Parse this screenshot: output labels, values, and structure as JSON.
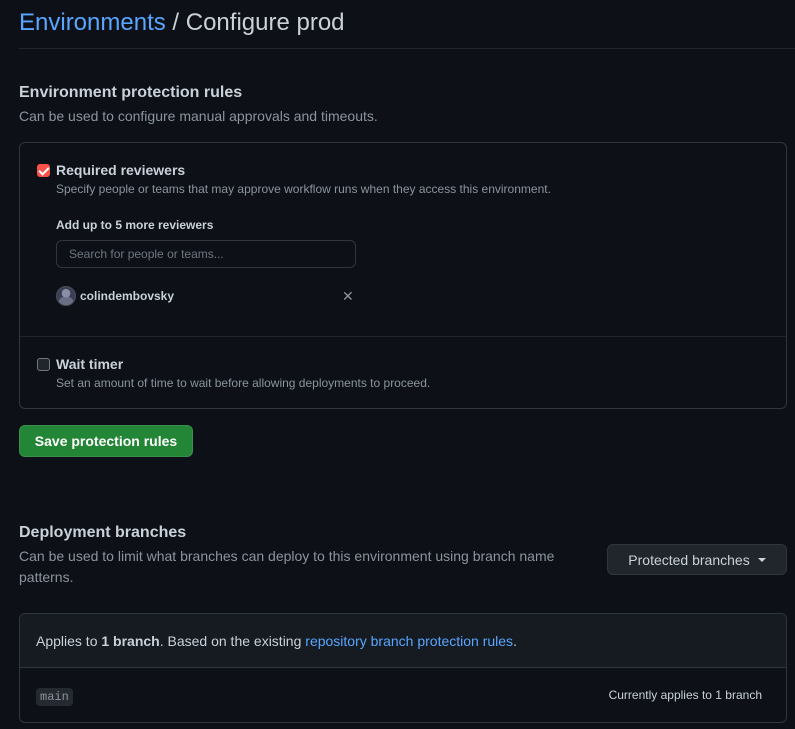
{
  "header": {
    "breadcrumb_link": "Environments",
    "separator": " / ",
    "page_title": "Configure prod"
  },
  "protection": {
    "heading": "Environment protection rules",
    "description": "Can be used to configure manual approvals and timeouts.",
    "required_reviewers": {
      "checked": true,
      "title": "Required reviewers",
      "description": "Specify people or teams that may approve workflow runs when they access this environment.",
      "add_label": "Add up to 5 more reviewers",
      "search_placeholder": "Search for people or teams...",
      "search_value": "",
      "reviewers": [
        {
          "username": "colindembovsky",
          "avatar_icon": "user-avatar",
          "remove_icon": "close-icon"
        }
      ]
    },
    "wait_timer": {
      "checked": false,
      "title": "Wait timer",
      "description": "Set an amount of time to wait before allowing deployments to proceed."
    },
    "save_label": "Save protection rules"
  },
  "deployment": {
    "heading": "Deployment branches",
    "description": "Can be used to limit what branches can deploy to this environment using branch name patterns.",
    "dropdown_label": "Protected branches",
    "applies_prefix": "Applies to ",
    "applies_count": "1 branch",
    "applies_middle": ". Based on the existing ",
    "applies_link": "repository branch protection rules",
    "applies_suffix": ".",
    "branches": [
      {
        "name": "main",
        "status": "Currently applies to 1 branch"
      }
    ]
  },
  "colors": {
    "background": "#0d1117",
    "link": "#58a6ff",
    "primary_button": "#238636",
    "checkbox_checked": "#f85149",
    "border": "#30363d"
  }
}
